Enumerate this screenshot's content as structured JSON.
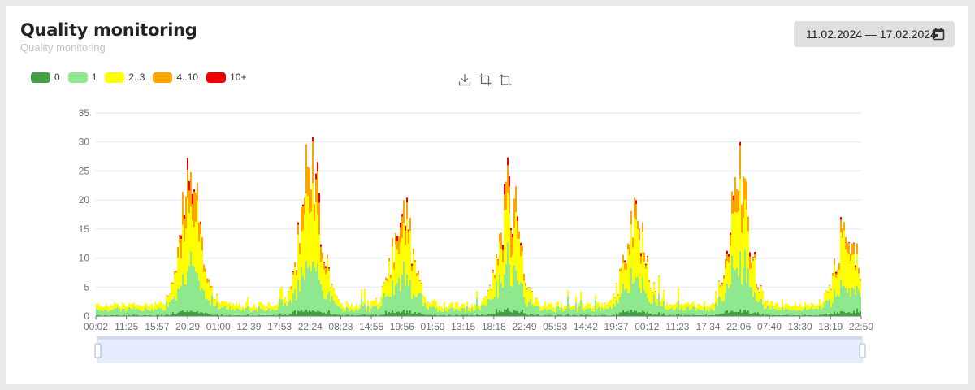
{
  "header": {
    "title": "Quality monitoring",
    "subtitle": "Quality monitoring"
  },
  "date_range": {
    "label": "11.02.2024 — 17.02.2024",
    "icon": "calendar-icon"
  },
  "toolbox": [
    {
      "name": "download-icon"
    },
    {
      "name": "zoom-area-icon"
    },
    {
      "name": "zoom-reset-icon"
    }
  ],
  "chart_data": {
    "type": "bar",
    "stacked": true,
    "ylim": [
      0,
      35
    ],
    "yticks": [
      0,
      5,
      10,
      15,
      20,
      25,
      30,
      35
    ],
    "xtick_labels": [
      "00:02",
      "11:25",
      "15:57",
      "20:29",
      "01:00",
      "12:39",
      "17:53",
      "22:24",
      "08:28",
      "14:55",
      "19:56",
      "01:59",
      "13:15",
      "18:18",
      "22:49",
      "05:53",
      "14:42",
      "19:37",
      "00:12",
      "11:23",
      "17:34",
      "22:06",
      "07:40",
      "13:30",
      "18:19",
      "22:50"
    ],
    "grid": true,
    "legend_position": "top-left",
    "series": [
      {
        "name": "0",
        "color": "#43a047"
      },
      {
        "name": "1",
        "color": "#8ee98e"
      },
      {
        "name": "2..3",
        "color": "#ffff00"
      },
      {
        "name": "4..10",
        "color": "#ffa500"
      },
      {
        "name": "10+",
        "color": "#ee0000"
      }
    ],
    "envelope_peaks": [
      {
        "x_index": 3.1,
        "total": 31
      },
      {
        "x_index": 7.0,
        "total": 34
      },
      {
        "x_index": 10.0,
        "total": 23
      },
      {
        "x_index": 13.5,
        "total": 26
      },
      {
        "x_index": 17.6,
        "total": 21
      },
      {
        "x_index": 21.0,
        "total": 31
      },
      {
        "x_index": 24.5,
        "total": 20
      }
    ],
    "baseline_total": 2.5,
    "slider": {
      "start": 0,
      "end": 100
    }
  }
}
